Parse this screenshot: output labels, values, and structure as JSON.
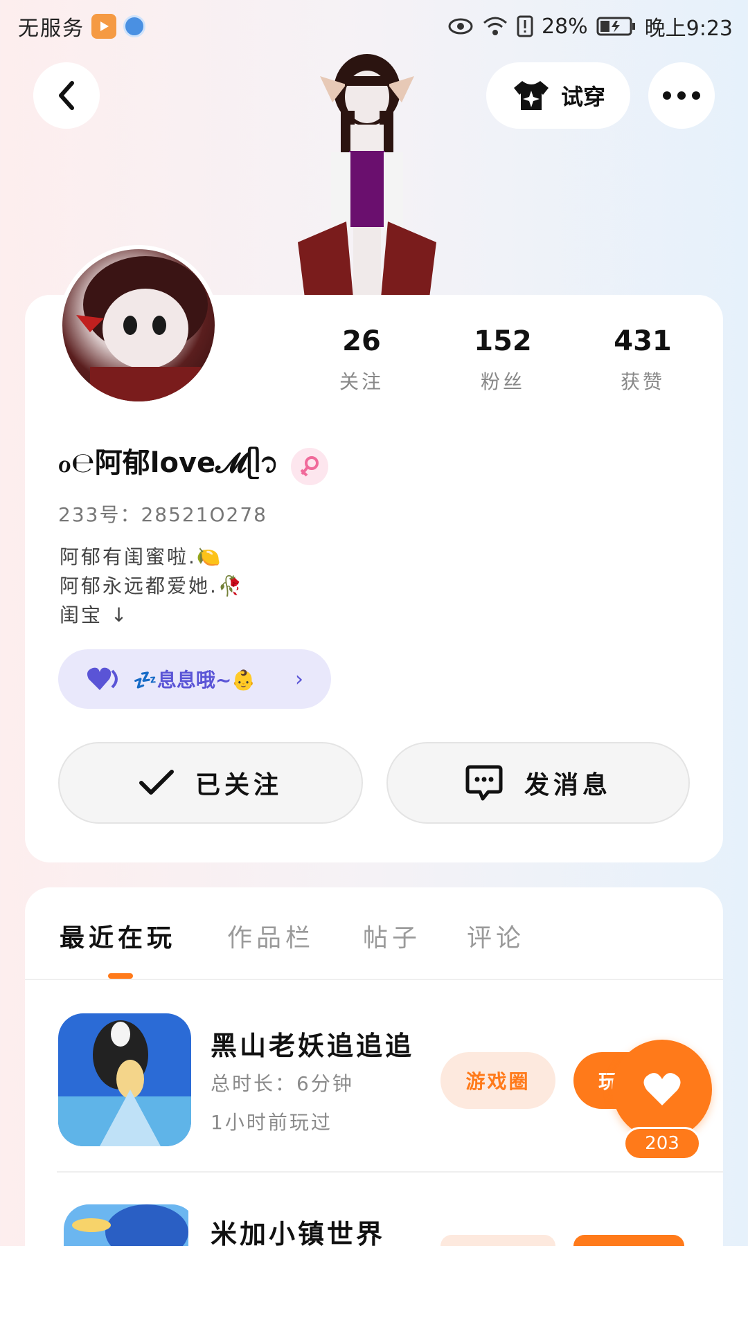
{
  "status_bar": {
    "carrier": "无服务",
    "battery": "28%",
    "time": "晚上9:23"
  },
  "header": {
    "try_on_label": "试穿"
  },
  "profile": {
    "username": "ℴ℮阿郁love𝓜ᥫ᭡",
    "id_line": "233号：28521O278",
    "bio_lines": [
      "阿郁有闺蜜啦.🍋",
      "阿郁永远都爱她.🥀",
      "闺宝  ↓"
    ],
    "status_text": "💤息息哦~👶",
    "stats": [
      {
        "value": "26",
        "label": "关注"
      },
      {
        "value": "152",
        "label": "粉丝"
      },
      {
        "value": "431",
        "label": "获赞"
      }
    ],
    "follow_label": "已关注",
    "message_label": "发消息"
  },
  "tabs": [
    {
      "label": "最近在玩",
      "active": true
    },
    {
      "label": "作品栏",
      "active": false
    },
    {
      "label": "帖子",
      "active": false
    },
    {
      "label": "评论",
      "active": false
    }
  ],
  "games": [
    {
      "title": "黑山老妖追追追",
      "duration": "总时长：6分钟",
      "last_played": "1小时前玩过",
      "circle_label": "游戏圈",
      "play_label": "玩"
    },
    {
      "title": "米加小镇世界"
    }
  ],
  "fab": {
    "count": "203"
  },
  "colors": {
    "accent": "#ff7a1a",
    "status_pill_bg": "#e9e8fb",
    "status_pill_text": "#5a54d6"
  }
}
